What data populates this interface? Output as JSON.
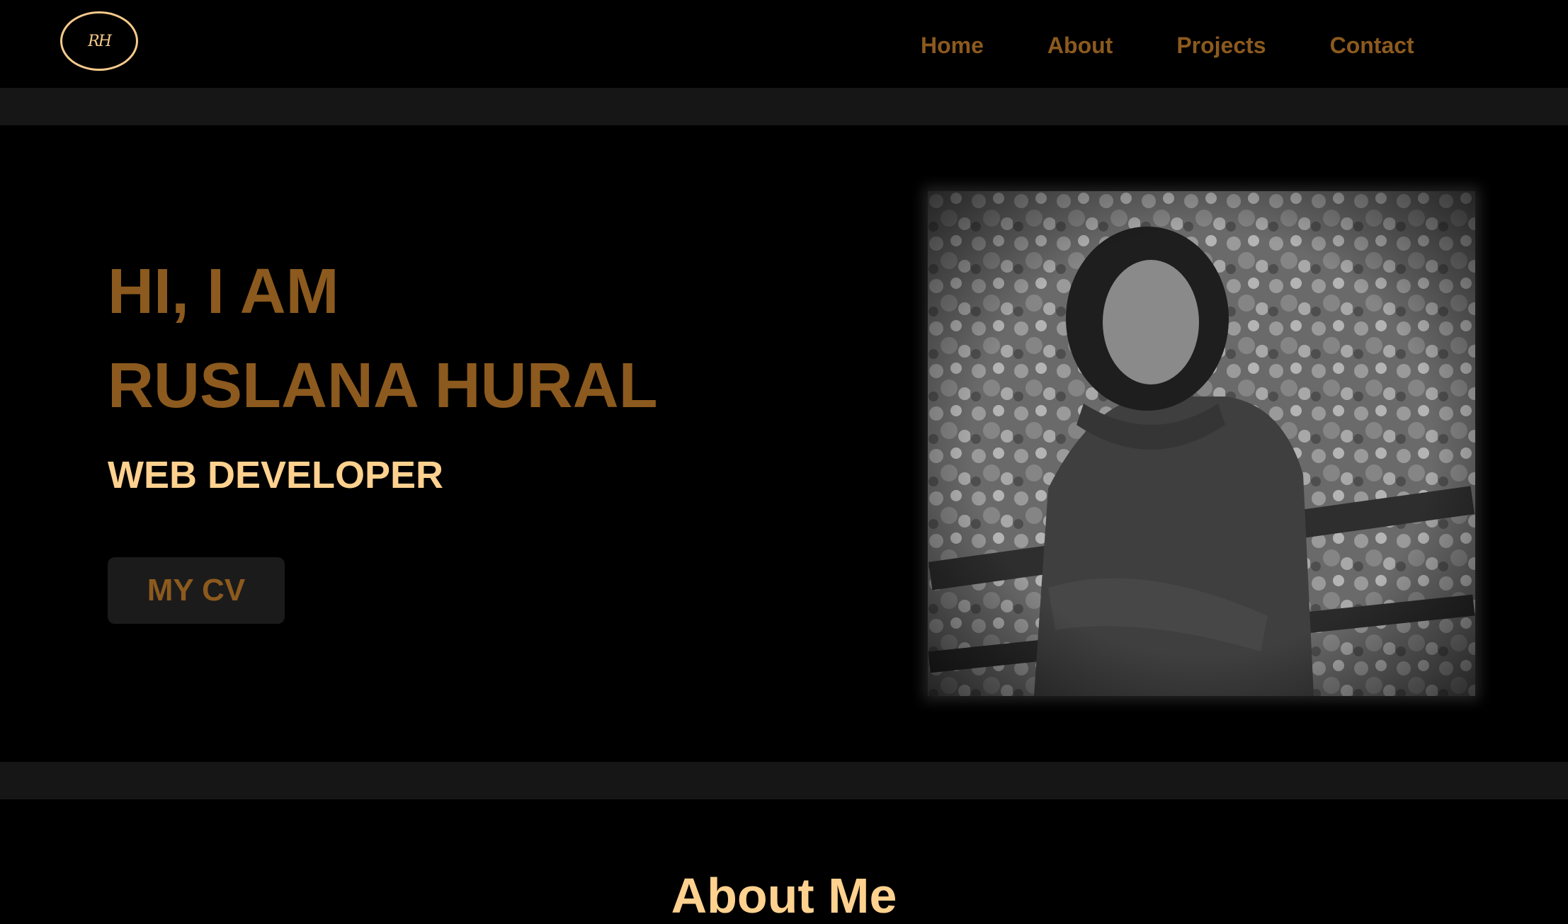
{
  "header": {
    "logo_text": "RH",
    "nav": [
      "Home",
      "About",
      "Projects",
      "Contact"
    ]
  },
  "hero": {
    "greeting": "HI, I AM",
    "name": "RUSLANA HURAL",
    "role": "WEB DEVELOPER",
    "cv_button": "MY CV",
    "photo_alt": "Portrait photo"
  },
  "about": {
    "title": "About Me"
  },
  "colors": {
    "background": "#000000",
    "band": "#161616",
    "accent_dark": "#8c5a1e",
    "accent_light": "#ffd18f"
  }
}
